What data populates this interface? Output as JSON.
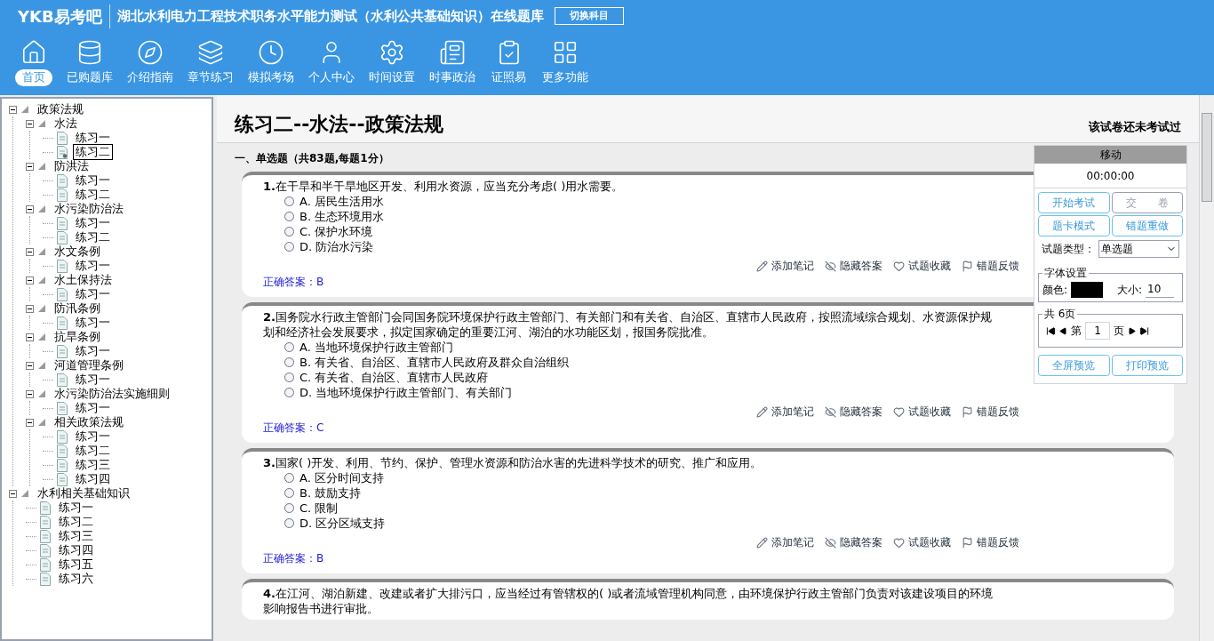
{
  "header": {
    "logo": "YKB易考吧",
    "title": "湖北水利电力工程技术职务水平能力测试（水利公共基础知识）在线题库",
    "switch_button": "切换科目"
  },
  "nav": [
    {
      "label": "首页",
      "selected": true
    },
    {
      "label": "已购题库",
      "selected": false
    },
    {
      "label": "介绍指南",
      "selected": false
    },
    {
      "label": "章节练习",
      "selected": false
    },
    {
      "label": "模拟考场",
      "selected": false
    },
    {
      "label": "个人中心",
      "selected": false
    },
    {
      "label": "时间设置",
      "selected": false
    },
    {
      "label": "时事政治",
      "selected": false
    },
    {
      "label": "证照易",
      "selected": false
    },
    {
      "label": "更多功能",
      "selected": false
    }
  ],
  "tree": [
    {
      "label": "政策法规",
      "expanded": true,
      "children": [
        {
          "label": "水法",
          "expanded": true,
          "children": [
            {
              "label": "练习一",
              "selected": false
            },
            {
              "label": "练习二",
              "selected": true
            }
          ]
        },
        {
          "label": "防洪法",
          "expanded": true,
          "children": [
            {
              "label": "练习一",
              "selected": false
            },
            {
              "label": "练习二",
              "selected": false
            }
          ]
        },
        {
          "label": "水污染防治法",
          "expanded": true,
          "children": [
            {
              "label": "练习一",
              "selected": false
            },
            {
              "label": "练习二",
              "selected": false
            }
          ]
        },
        {
          "label": "水文条例",
          "expanded": true,
          "children": [
            {
              "label": "练习一",
              "selected": false
            }
          ]
        },
        {
          "label": "水土保持法",
          "expanded": true,
          "children": [
            {
              "label": "练习一",
              "selected": false
            }
          ]
        },
        {
          "label": "防汛条例",
          "expanded": true,
          "children": [
            {
              "label": "练习一",
              "selected": false
            }
          ]
        },
        {
          "label": "抗旱条例",
          "expanded": true,
          "children": [
            {
              "label": "练习一",
              "selected": false
            }
          ]
        },
        {
          "label": "河道管理条例",
          "expanded": true,
          "children": [
            {
              "label": "练习一",
              "selected": false
            }
          ]
        },
        {
          "label": "水污染防治法实施细则",
          "expanded": true,
          "children": [
            {
              "label": "练习一",
              "selected": false
            }
          ]
        },
        {
          "label": "相关政策法规",
          "expanded": true,
          "children": [
            {
              "label": "练习一",
              "selected": false
            },
            {
              "label": "练习二",
              "selected": false
            },
            {
              "label": "练习三",
              "selected": false
            },
            {
              "label": "练习四",
              "selected": false
            }
          ]
        }
      ]
    },
    {
      "label": "水利相关基础知识",
      "expanded": true,
      "children": [
        {
          "label": "练习一",
          "selected": false
        },
        {
          "label": "练习二",
          "selected": false
        },
        {
          "label": "练习三",
          "selected": false
        },
        {
          "label": "练习四",
          "selected": false
        },
        {
          "label": "练习五",
          "selected": false
        },
        {
          "label": "练习六",
          "selected": false
        }
      ]
    }
  ],
  "paper": {
    "title": "练习二--水法--政策法规",
    "status": "该试卷还未考试过",
    "section": "一、单选题（共83题,每题1分）"
  },
  "questions": [
    {
      "number": "1.",
      "text": "在干旱和半干旱地区开发、利用水资源，应当充分考虑( )用水需要。",
      "options": [
        {
          "text": "A. 居民生活用水",
          "selected": false
        },
        {
          "text": "B. 生态环境用水",
          "selected": false
        },
        {
          "text": "C. 保护水环境",
          "selected": false
        },
        {
          "text": "D. 防治水污染",
          "selected": false
        }
      ],
      "actions": [
        "添加笔记",
        "隐藏答案",
        "试题收藏",
        "错题反馈"
      ],
      "answer_label": "正确答案：",
      "answer": "B"
    },
    {
      "number": "2.",
      "text": "国务院水行政主管部门会同国务院环境保护行政主管部门、有关部门和有关省、自治区、直辖市人民政府，按照流域综合规划、水资源保护规划和经济社会发展要求，拟定国家确定的重要江河、湖泊的水功能区划，报国务院批准。",
      "options": [
        {
          "text": "A. 当地环境保护行政主管部门",
          "selected": false
        },
        {
          "text": "B. 有关省、自治区、直辖市人民政府及群众自治组织",
          "selected": false
        },
        {
          "text": "C. 有关省、自治区、直辖市人民政府",
          "selected": false
        },
        {
          "text": "D. 当地环境保护行政主管部门、有关部门",
          "selected": false
        }
      ],
      "actions": [
        "添加笔记",
        "隐藏答案",
        "试题收藏",
        "错题反馈"
      ],
      "answer_label": "正确答案：",
      "answer": "C"
    },
    {
      "number": "3.",
      "text": "国家( )开发、利用、节约、保护、管理水资源和防治水害的先进科学技术的研究、推广和应用。",
      "options": [
        {
          "text": "A. 区分时间支持",
          "selected": false
        },
        {
          "text": "B. 鼓励支持",
          "selected": false
        },
        {
          "text": "C. 限制",
          "selected": false
        },
        {
          "text": "D. 区分区域支持",
          "selected": false
        }
      ],
      "actions": [
        "添加笔记",
        "隐藏答案",
        "试题收藏",
        "错题反馈"
      ],
      "answer_label": "正确答案：",
      "answer": "B"
    },
    {
      "number": "4.",
      "text": "在江河、湖泊新建、改建或者扩大排污口，应当经过有管辖权的( )或者流域管理机构同意，由环境保护行政主管部门负责对该建设项目的环境影响报告书进行审批。"
    }
  ],
  "panel": {
    "title": "移动",
    "timer": "00:00:00",
    "buttons": [
      {
        "label": "开始考试",
        "disabled": false
      },
      {
        "label": "交　　卷",
        "disabled": true
      },
      {
        "label": "题卡模式",
        "disabled": false
      },
      {
        "label": "错题重做",
        "disabled": false
      }
    ],
    "type_label": "试题类型：",
    "type_value": "单选题",
    "font_legend": "字体设置",
    "color_label": "颜色:",
    "color": "#000000",
    "size_label": "大小:",
    "size": "10",
    "pages_legend": "共 6页",
    "page_prefix": "第",
    "page": "1",
    "page_suffix": "页",
    "bottom_buttons": [
      "全屏预览",
      "打印预览"
    ]
  }
}
